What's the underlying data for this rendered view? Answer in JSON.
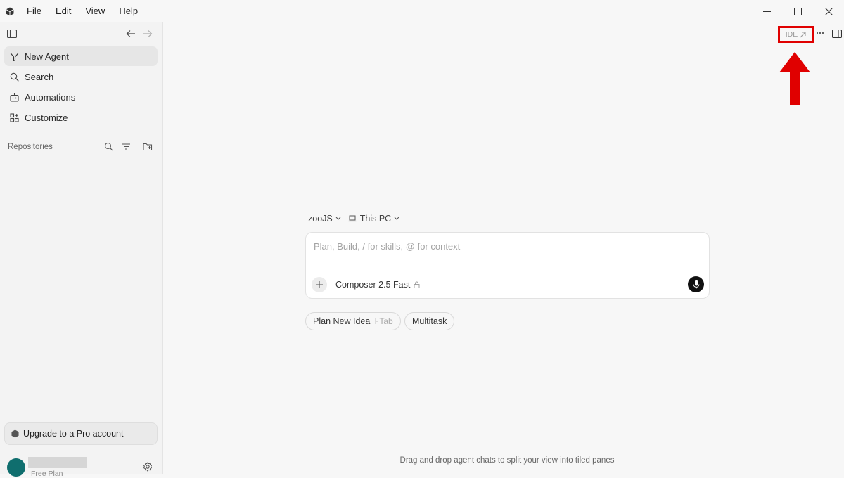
{
  "menu": [
    "File",
    "Edit",
    "View",
    "Help"
  ],
  "sidebar": {
    "nav": [
      {
        "label": "New Agent",
        "icon": "funnel-icon",
        "active": true
      },
      {
        "label": "Search",
        "icon": "search-icon"
      },
      {
        "label": "Automations",
        "icon": "robot-icon"
      },
      {
        "label": "Customize",
        "icon": "grid-plus-icon"
      }
    ],
    "repositories_label": "Repositories",
    "upgrade_label": "Upgrade to a Pro account",
    "plan_label": "Free Plan"
  },
  "main": {
    "ide_label": "IDE",
    "context": {
      "project": "zooJS",
      "location": "This PC"
    },
    "composer": {
      "placeholder": "Plan, Build, / for skills, @ for context",
      "model": "Composer 2.5 Fast"
    },
    "chips": {
      "plan_label": "Plan New Idea",
      "plan_shortcut": "Tab",
      "multitask_label": "Multitask"
    },
    "footer_hint": "Drag and drop agent chats to split your view into tiled panes"
  },
  "colors": {
    "highlight": "#e00000",
    "avatar": "#0f6e6e"
  }
}
